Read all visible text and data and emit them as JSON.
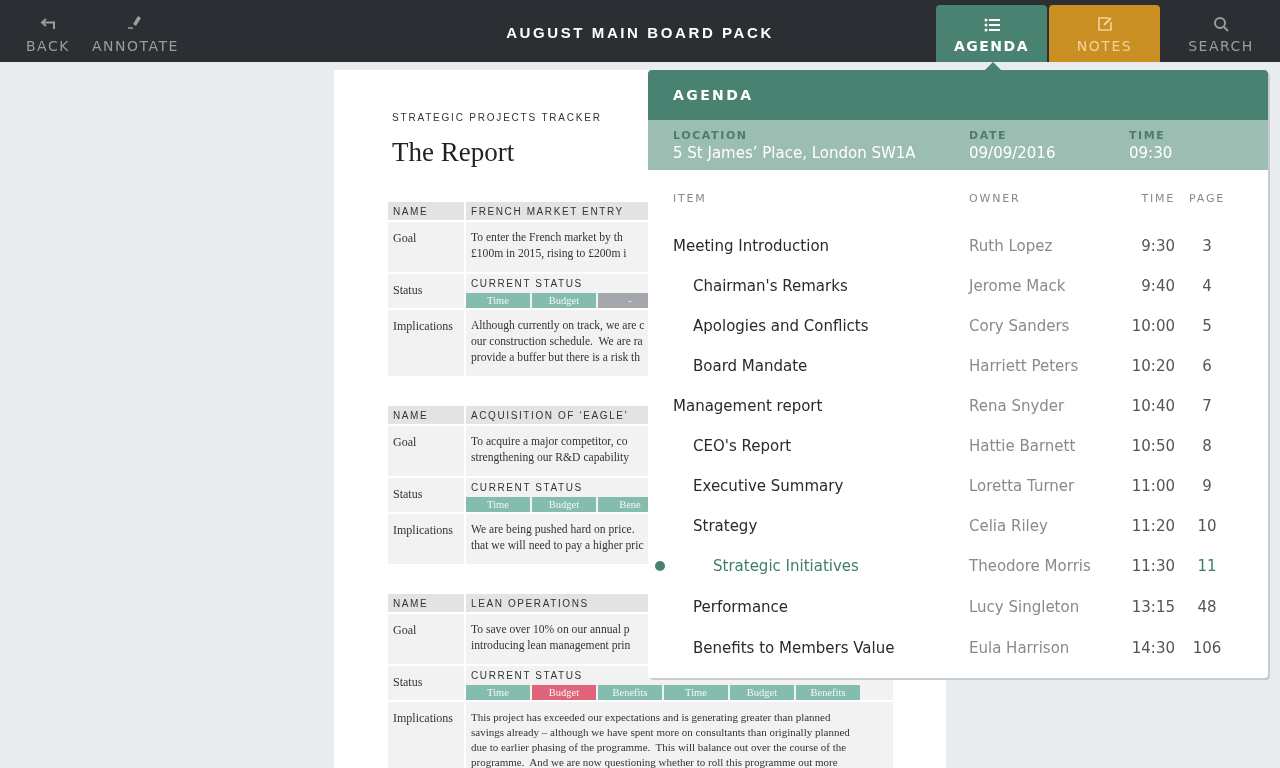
{
  "toolbar": {
    "left": [
      {
        "label": "BACK"
      },
      {
        "label": "ANNOTATE"
      }
    ],
    "title": "AUGUST MAIN BOARD PACK",
    "tabs": [
      {
        "label": "AGENDA",
        "selected": true,
        "color": "#4a8272"
      },
      {
        "label": "NOTES",
        "selected": false,
        "color": "#c98f22"
      },
      {
        "label": "SEARCH",
        "selected": false
      }
    ]
  },
  "document": {
    "section_label": "STRATEGIC PROJECTS TRACKER",
    "title": "The Report",
    "projects": [
      {
        "name_label": "NAME",
        "name": "FRENCH MARKET ENTRY",
        "rows": [
          {
            "kind": "text",
            "label": "Goal",
            "text": "To enter the French market by th\n£100m in 2015, rising to £200m i"
          },
          {
            "kind": "status",
            "label": "Status",
            "heading": "CURRENT STATUS",
            "segments": [
              {
                "label": "Time",
                "color": "#84bcad"
              },
              {
                "label": "Budget",
                "color": "#84bcad"
              },
              {
                "label": "-",
                "color": "#a4a7ab"
              }
            ]
          },
          {
            "kind": "text",
            "label": "Implications",
            "text": "Although currently on track, we are c\nour construction schedule.  We are ra\nprovide a buffer but there is a risk th"
          }
        ]
      },
      {
        "name_label": "NAME",
        "name": "ACQUISITION OF ‘EAGLE’",
        "rows": [
          {
            "kind": "text",
            "label": "Goal",
            "text": "To acquire a major competitor, co\nstrengthening our R&D capability"
          },
          {
            "kind": "status",
            "label": "Status",
            "heading": "CURRENT STATUS",
            "segments": [
              {
                "label": "Time",
                "color": "#84bcad"
              },
              {
                "label": "Budget",
                "color": "#84bcad"
              },
              {
                "label": "Bene",
                "color": "#84bcad"
              }
            ]
          },
          {
            "kind": "text",
            "label": "Implications",
            "text": "We are being pushed hard on price.\nthat we will need to pay a higher pric"
          }
        ]
      },
      {
        "name_label": "NAME",
        "name": "LEAN OPERATIONS",
        "rows": [
          {
            "kind": "text",
            "label": "Goal",
            "text": "To save over 10% on our annual p\nintroducing lean management prin"
          },
          {
            "kind": "status",
            "label": "Status",
            "heading": "CURRENT STATUS",
            "segments": [
              {
                "label": "Time",
                "color": "#84bcad"
              },
              {
                "label": "Budget",
                "color": "#df6479"
              },
              {
                "label": "Benefits",
                "color": "#84bcad"
              },
              {
                "label": "Time",
                "color": "#84bcad"
              },
              {
                "label": "Budget",
                "color": "#84bcad"
              },
              {
                "label": "Benefits",
                "color": "#84bcad"
              }
            ]
          },
          {
            "kind": "text",
            "label": "Implications",
            "text": "This project has exceeded our expectations and is generating greater than planned\nsavings already – although we have spent more on consultants than originally planned\ndue to earlier phasing of the programme.  This will balance out over the course of the\nprogramme.  And we are now questioning whether to roll this programme out more"
          }
        ]
      }
    ]
  },
  "agenda": {
    "title": "AGENDA",
    "meta": [
      {
        "label": "LOCATION",
        "value": "5 St James’ Place, London SW1A"
      },
      {
        "label": "DATE",
        "value": "09/09/2016"
      },
      {
        "label": "TIME",
        "value": "09:30"
      }
    ],
    "columns": [
      "ITEM",
      "OWNER",
      "TIME",
      "PAGE"
    ],
    "items": [
      {
        "item": "Meeting Introduction",
        "owner": "Ruth Lopez",
        "time": "9:30",
        "page": "3",
        "selected": false,
        "children": [
          {
            "item": "Chairman's Remarks",
            "owner": "Jerome Mack",
            "time": "9:40",
            "page": "4",
            "selected": false
          },
          {
            "item": "Apologies and Conflicts",
            "owner": "Cory Sanders",
            "time": "10:00",
            "page": "5",
            "selected": false
          },
          {
            "item": "Board Mandate",
            "owner": "Harriett Peters",
            "time": "10:20",
            "page": "6",
            "selected": false
          }
        ]
      },
      {
        "item": "Management report",
        "owner": "Rena Snyder",
        "time": "10:40",
        "page": "7",
        "selected": false,
        "children": [
          {
            "item": "CEO's Report",
            "owner": "Hattie Barnett",
            "time": "10:50",
            "page": "8",
            "selected": false
          },
          {
            "item": "Executive Summary",
            "owner": "Loretta Turner",
            "time": "11:00",
            "page": "9",
            "selected": false
          },
          {
            "item": "Strategy",
            "owner": "Celia Riley",
            "time": "11:20",
            "page": "10",
            "selected": false,
            "children": [
              {
                "item": "Strategic Initiatives",
                "owner": "Theodore Morris",
                "time": "11:30",
                "page": "11",
                "selected": true
              }
            ]
          },
          {
            "item": "Performance",
            "owner": "Lucy Singleton",
            "time": "13:15",
            "page": "48",
            "selected": false
          },
          {
            "item": "Benefits to Members Value",
            "owner": "Eula Harrison",
            "time": "14:30",
            "page": "106",
            "selected": false
          }
        ]
      }
    ]
  }
}
